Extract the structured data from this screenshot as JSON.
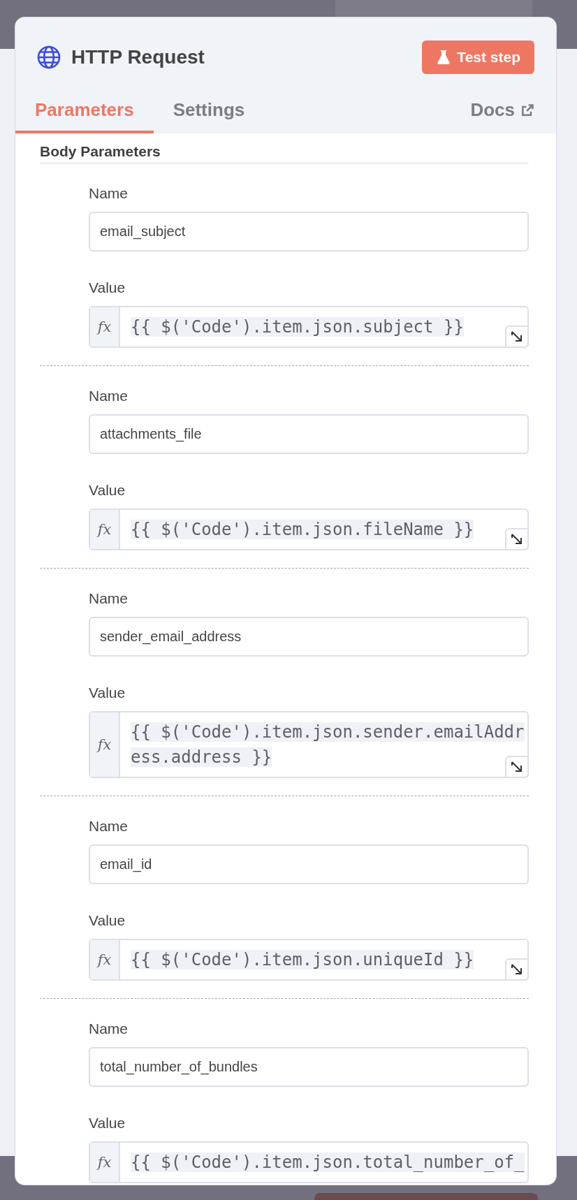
{
  "node": {
    "title": "HTTP Request",
    "test_button": "Test step"
  },
  "tabs": [
    {
      "label": "Parameters",
      "selected": true
    },
    {
      "label": "Settings",
      "selected": false
    }
  ],
  "docs_link": "Docs",
  "section_title": "Body Parameters",
  "parameters": [
    {
      "name_label": "Name",
      "name": "email_subject",
      "value_label": "Value",
      "fx_label": "fx",
      "value": "{{ $('Code').item.json.subject }}",
      "expand_icon": true
    },
    {
      "name_label": "Name",
      "name": "attachments_file",
      "value_label": "Value",
      "fx_label": "fx",
      "value": "{{ $('Code').item.json.fileName }}",
      "expand_icon": true
    },
    {
      "name_label": "Name",
      "name": "sender_email_address",
      "value_label": "Value",
      "fx_label": "fx",
      "value": "{{ $('Code').item.json.sender.emailAddress.address }}",
      "expand_icon": true
    },
    {
      "name_label": "Name",
      "name": "email_id",
      "value_label": "Value",
      "fx_label": "fx",
      "value": "{{ $('Code').item.json.uniqueId }}",
      "expand_icon": true
    },
    {
      "name_label": "Name",
      "name": "total_number_of_bundles",
      "value_label": "Value",
      "fx_label": "fx",
      "value": "{{ $('Code').item.json.total_number_of_",
      "expand_icon": false
    }
  ]
}
